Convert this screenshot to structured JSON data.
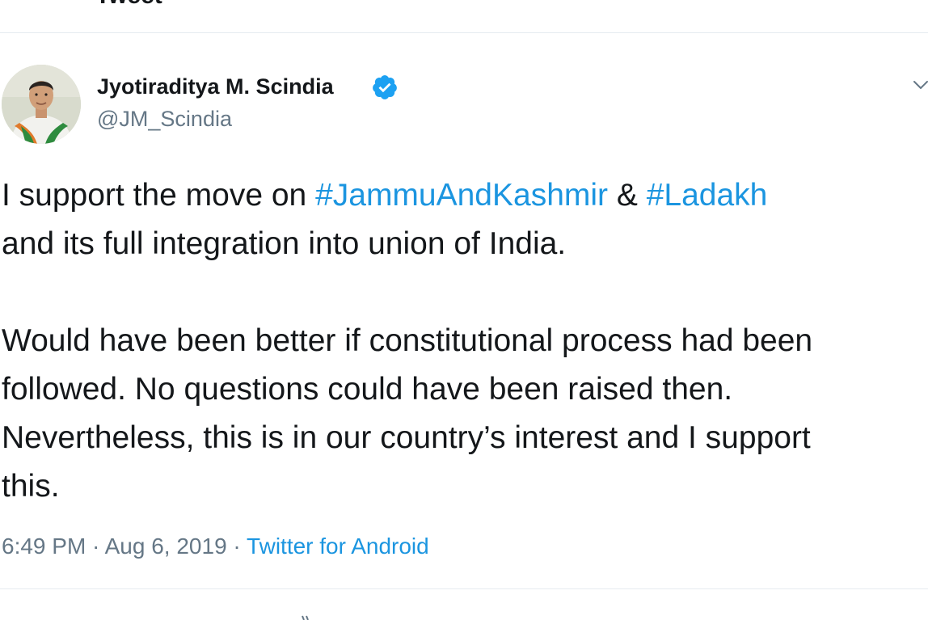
{
  "header": {
    "partial_title": "Tweet"
  },
  "author": {
    "display_name": "Jyotiraditya M. Scindia",
    "handle": "@JM_Scindia",
    "verified": true,
    "avatar_icon": "profile-photo-icon"
  },
  "tweet": {
    "line1_prefix": "I support the move on ",
    "hashtag1": "#JammuAndKashmir",
    "line1_mid": " & ",
    "hashtag2": "#Ladakh",
    "line2": "and its full integration into union of India.",
    "line3": "Would have been better if constitutional process had been",
    "line4": "followed. No questions could have been raised then.",
    "line5": "Nevertheless, this is in our country’s interest and I support",
    "line6": "this."
  },
  "meta": {
    "time": "6:49 PM",
    "separator": " · ",
    "date": "Aug 6, 2019",
    "source": "Twitter for Android"
  },
  "colors": {
    "link": "#1b95e0",
    "secondary_text": "#657786",
    "verified_badge": "#1da1f2",
    "divider": "#e6ecf0"
  }
}
